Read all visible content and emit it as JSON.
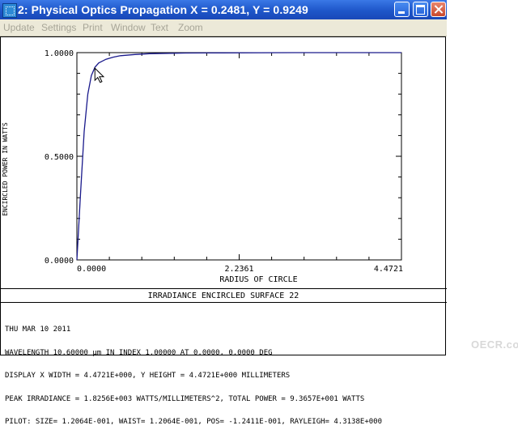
{
  "window": {
    "title": "2: Physical Optics Propagation X = 0.2481, Y = 0.9249",
    "buttons": {
      "minimize": "minimize",
      "maximize": "maximize",
      "close": "close"
    }
  },
  "menu": {
    "items": [
      "Update",
      "Settings",
      "Print",
      "Window",
      "Text",
      "Zoom"
    ]
  },
  "colors": {
    "curve": "#1a1a8c",
    "titlebar": "#1e56c9",
    "menu_text_disabled": "#a7a597"
  },
  "chart_data": {
    "type": "line",
    "title": "",
    "xlabel": "RADIUS OF CIRCLE",
    "ylabel": "ENCIRCLED POWER IN WATTS",
    "xlim": [
      0.0,
      4.4721
    ],
    "ylim": [
      0.0,
      1.0
    ],
    "x_ticks": [
      "0.0000",
      "2.2361",
      "4.4721"
    ],
    "y_ticks": [
      "0.0000",
      "0.5000",
      "1.0000"
    ],
    "grid": false,
    "series": [
      {
        "x": [
          0.0,
          0.05,
          0.1,
          0.15,
          0.2,
          0.25,
          0.3,
          0.4,
          0.5,
          0.6,
          0.8,
          1.0,
          1.5,
          2.0,
          3.0,
          4.4721
        ],
        "values": [
          0.0,
          0.32,
          0.62,
          0.8,
          0.89,
          0.93,
          0.95,
          0.968,
          0.978,
          0.985,
          0.991,
          0.995,
          0.998,
          0.999,
          1.0,
          1.0
        ]
      }
    ],
    "cursor": {
      "x": 0.2481,
      "y": 0.9249
    }
  },
  "footer": {
    "plot_title": "IRRADIANCE ENCIRCLED SURFACE 22",
    "lines": [
      "THU MAR 10 2011",
      "WAVELENGTH 10.60000 µm IN INDEX 1.00000 AT 0.0000, 0.0000 DEG",
      "DISPLAY X WIDTH = 4.4721E+000, Y HEIGHT = 4.4721E+000 MILLIMETERS",
      "PEAK IRRADIANCE = 1.8256E+003 WATTS/MILLIMETERS^2, TOTAL POWER = 9.3657E+001 WATTS",
      "PILOT: SIZE= 1.2064E-001, WAIST= 1.2064E-001, POS= -1.2411E-001, RAYLEIGH= 4.3138E+000"
    ]
  },
  "watermark": "OECR.com"
}
